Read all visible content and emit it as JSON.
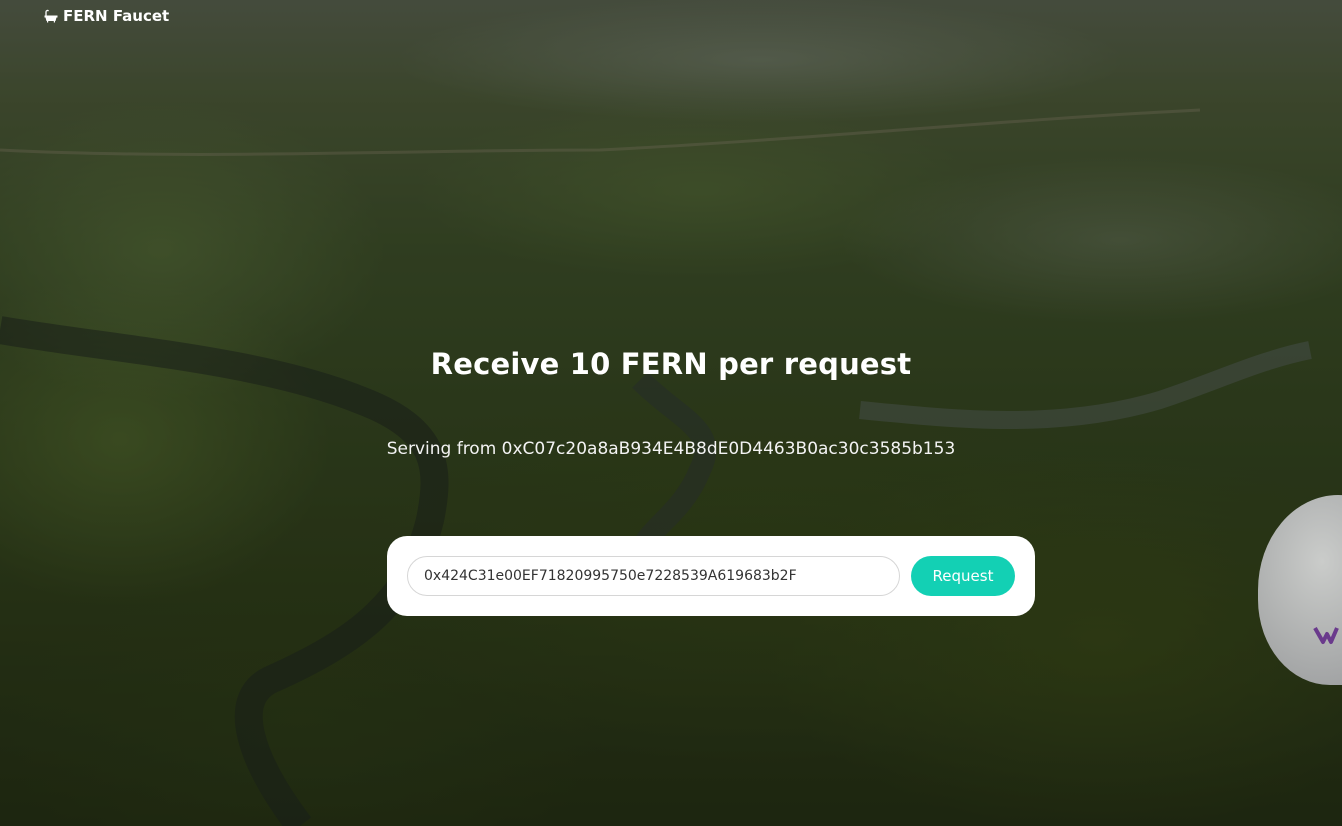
{
  "brand": {
    "icon": "bathtub-icon",
    "name": "FERN Faucet"
  },
  "hero": {
    "headline": "Receive 10 FERN per request",
    "serving_text": "Serving from 0xC07c20a8aB934E4B8dE0D4463B0ac30c3585b153"
  },
  "form": {
    "address_value": "0x424C31e00EF71820995750e7228539A619683b2F",
    "request_label": "Request"
  },
  "colors": {
    "accent": "#13d0b4",
    "card": "#ffffff",
    "text": "#ffffff"
  }
}
